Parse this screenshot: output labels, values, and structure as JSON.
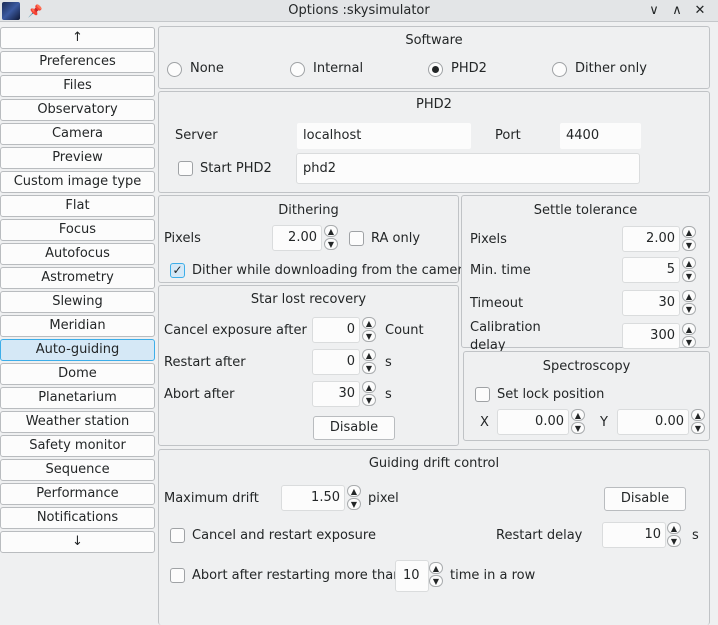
{
  "window": {
    "title": "Options :skysimulator",
    "pin": "📌",
    "minimize": "∨",
    "maximize": "∧",
    "close": "✕"
  },
  "sidebar": {
    "items": [
      "↑",
      "Preferences",
      "Files",
      "Observatory",
      "Camera",
      "Preview",
      "Custom image type",
      "Flat",
      "Focus",
      "Autofocus",
      "Astrometry",
      "Slewing",
      "Meridian",
      "Auto-guiding",
      "Dome",
      "Planetarium",
      "Weather station",
      "Safety monitor",
      "Sequence",
      "Performance",
      "Notifications",
      "↓"
    ],
    "selected": "Auto-guiding"
  },
  "software": {
    "title": "Software",
    "options": [
      "None",
      "Internal",
      "PHD2",
      "Dither only"
    ],
    "selected": "PHD2"
  },
  "phd2": {
    "title": "PHD2",
    "server_label": "Server",
    "server": "localhost",
    "port_label": "Port",
    "port": "4400",
    "start_label": "Start PHD2",
    "start_checked": false,
    "command": "phd2"
  },
  "dithering": {
    "title": "Dithering",
    "pixels_label": "Pixels",
    "pixels": "2.00",
    "ra_only_label": "RA only",
    "ra_only": false,
    "dither_dl_label": "Dither while downloading from the camera",
    "dither_dl": true
  },
  "settle": {
    "title": "Settle tolerance",
    "pixels_label": "Pixels",
    "pixels": "2.00",
    "min_time_label": "Min. time",
    "min_time": "5",
    "timeout_label": "Timeout",
    "timeout": "30",
    "calib_label_1": "Calibration",
    "calib_label_2": "delay",
    "calib": "300"
  },
  "starlost": {
    "title": "Star lost recovery",
    "cancel_label": "Cancel exposure after",
    "cancel": "0",
    "cancel_unit": "Count",
    "restart_label": "Restart after",
    "restart": "0",
    "restart_unit": "s",
    "abort_label": "Abort after",
    "abort": "30",
    "abort_unit": "s",
    "disable": "Disable"
  },
  "spectro": {
    "title": "Spectroscopy",
    "lock_label": "Set lock position",
    "lock": false,
    "x_label": "X",
    "x": "0.00",
    "y_label": "Y",
    "y": "0.00"
  },
  "drift": {
    "title": "Guiding drift control",
    "max_label": "Maximum drift",
    "max": "1.50",
    "max_unit": "pixel",
    "disable": "Disable",
    "cancel_label": "Cancel and restart exposure",
    "cancel": false,
    "restart_delay_label": "Restart delay",
    "restart_delay": "10",
    "restart_delay_unit": "s",
    "abort_label": "Abort after restarting more than",
    "abort": "10",
    "abort_unit": "time in a row",
    "abort_checked": false
  },
  "icons": {
    "spin_up": "▲",
    "spin_down": "▼",
    "check": "✓"
  }
}
